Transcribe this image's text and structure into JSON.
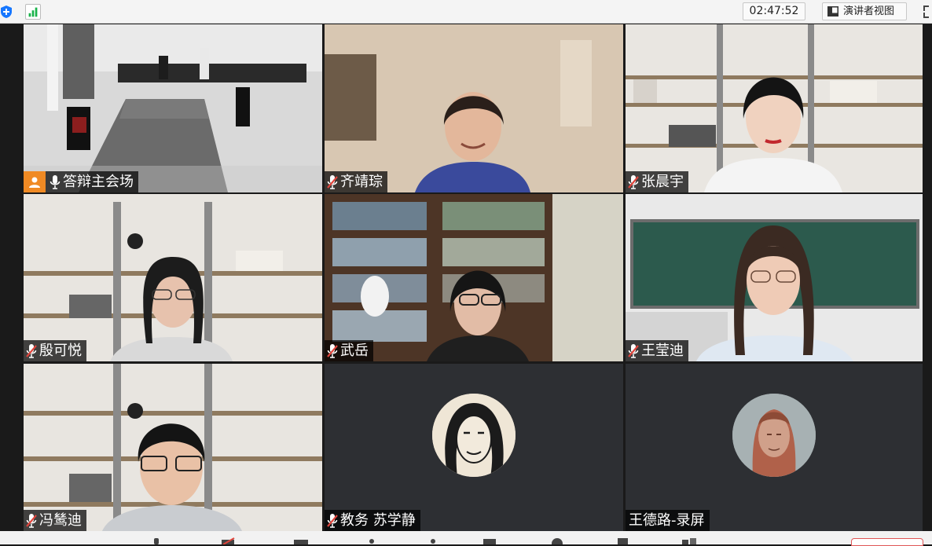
{
  "topbar": {
    "timer": "02:47:52",
    "presenter_view_label": "演讲者视图"
  },
  "participants": [
    {
      "name": "答辩主会场",
      "muted": false,
      "host": true
    },
    {
      "name": "齐靖琮",
      "muted": true,
      "host": false
    },
    {
      "name": "张晨宇",
      "muted": true,
      "host": false
    },
    {
      "name": "殷可悦",
      "muted": true,
      "host": false
    },
    {
      "name": "武岳",
      "muted": true,
      "host": false
    },
    {
      "name": "王莹迪",
      "muted": true,
      "host": false
    },
    {
      "name": "冯鸶迪",
      "muted": true,
      "host": false
    },
    {
      "name": "教务 苏学静",
      "muted": true,
      "host": false
    },
    {
      "name": "王德路-录屏",
      "muted": false,
      "host": false
    }
  ],
  "colors": {
    "muted_mic": "#e0443c",
    "host_badge": "#f08a24",
    "tile_bg": "#2d2f33"
  }
}
